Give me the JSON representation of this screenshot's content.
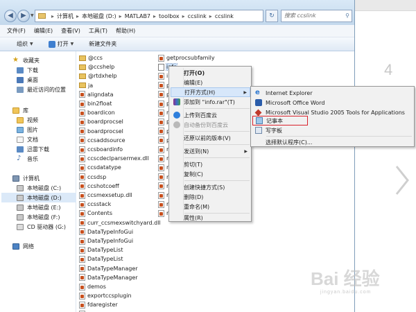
{
  "address": {
    "breadcrumb": [
      "计算机",
      "本地磁盘 (D:)",
      "MATLAB7",
      "toolbox",
      "ccslink",
      "ccslink"
    ],
    "search_placeholder": "搜索 ccslink"
  },
  "menubar": [
    "文件(F)",
    "编辑(E)",
    "查看(V)",
    "工具(T)",
    "帮助(H)"
  ],
  "toolbar": {
    "organize": "组织",
    "open": "打开",
    "new_folder": "新建文件夹"
  },
  "sidebar": {
    "favorites": {
      "title": "收藏夹",
      "items": [
        "下载",
        "桌面",
        "最近访问的位置"
      ]
    },
    "libraries": {
      "title": "库",
      "items": [
        "视频",
        "图片",
        "文档",
        "迅雷下载",
        "音乐"
      ]
    },
    "computer": {
      "title": "计算机",
      "items": [
        "本地磁盘 (C:)",
        "本地磁盘 (D:)",
        "本地磁盘 (E:)",
        "本地磁盘 (F:)",
        "CD 驱动器 (G:)"
      ],
      "selected": "本地磁盘 (D:)"
    },
    "network": {
      "title": "网络"
    }
  },
  "files": {
    "col1": [
      "@ccs",
      "@ccshelp",
      "@rtdxhelp",
      "ja",
      "aligndata",
      "bin2float",
      "boardicon",
      "boardprocsel",
      "boardprocsel",
      "ccsaddsource",
      "ccsboardinfo",
      "ccscdeclparsermex.dll",
      "ccsdatatype",
      "ccsdsp",
      "ccshotcoeff",
      "ccsmexsetup.dll",
      "ccsstack",
      "Contents",
      "curr_ccsmexswitchyard.dll",
      "DataTypeInfoGui",
      "DataTypeInfoGui",
      "DataTypeList",
      "DataTypeList",
      "DataTypeManager",
      "DataTypeManager",
      "demos",
      "exportccsplugin",
      "fdaregister",
      "generateccsmsgid"
    ],
    "col1_types": [
      "folder",
      "folder",
      "folder",
      "folder",
      "m",
      "m",
      "m",
      "m",
      "m",
      "m",
      "m",
      "m",
      "m",
      "m",
      "m",
      "m",
      "m",
      "m",
      "m",
      "m",
      "m",
      "m",
      "m",
      "m",
      "m",
      "m",
      "m",
      "m",
      "m"
    ],
    "col2_visible": [
      "getprocsubfamily",
      "info"
    ],
    "col2_partial": [
      "i",
      "p",
      "p",
      "p",
      "r",
      "p",
      "p",
      "p",
      "r",
      "r",
      "r",
      "r",
      "r",
      "r",
      "r",
      "r"
    ]
  },
  "context_menu": {
    "items": [
      "打开(O)",
      "编辑(E)",
      "打开方式(H)",
      "添加到 \"info.rar\"(T)",
      "上传到百度云",
      "自动备份到百度云",
      "还原以前的版本(V)",
      "发送到(N)",
      "剪切(T)",
      "复制(C)",
      "创建快捷方式(S)",
      "删除(D)",
      "重命名(M)",
      "属性(R)"
    ]
  },
  "submenu": {
    "items": [
      "Internet Explorer",
      "Microsoft Office Word",
      "Microsoft Visual Studio 2005 Tools for Applications",
      "记事本",
      "写字板",
      "选择默认程序(C)..."
    ]
  },
  "backdrop": {
    "page_fragment": "4"
  },
  "watermark": {
    "logo": "Bai 经验",
    "url": "jingyan.baidu.com"
  }
}
